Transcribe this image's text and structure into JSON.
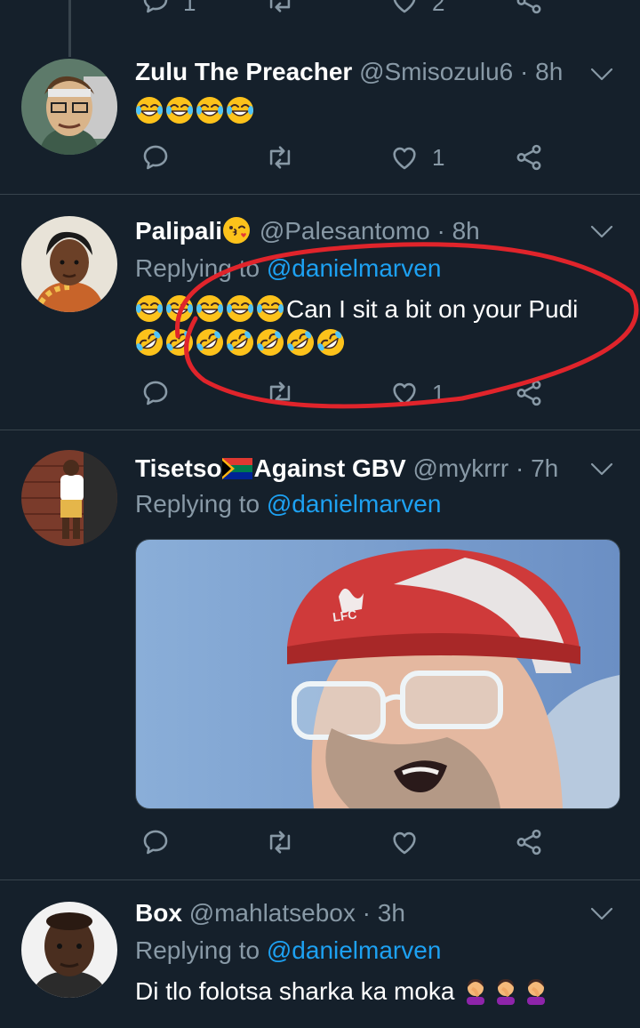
{
  "top_partial": {
    "reply_count": "1",
    "like_count": "2"
  },
  "tweets": [
    {
      "name": "Zulu The Preacher",
      "handle": "@Smisozulu6",
      "time": "8h",
      "text": "",
      "text_emojis": [
        "joy",
        "joy",
        "joy",
        "joy"
      ],
      "reply_count": "",
      "retweet_count": "",
      "like_count": "1"
    },
    {
      "name": "Palipali",
      "name_emoji": "kissing-heart",
      "handle": "@Palesantomo",
      "time": "8h",
      "replying_prefix": "Replying to",
      "replying_to": "@danielmarven",
      "text_line1": "Can I sit a bit on your Pudi",
      "text_line1_emojis": [
        "joy",
        "joy",
        "joy",
        "joy",
        "joy"
      ],
      "text_line2_emojis": [
        "rofl",
        "rofl",
        "rofl",
        "rofl",
        "rofl",
        "rofl",
        "rofl"
      ],
      "like_count": "1"
    },
    {
      "name": "Tisetso",
      "name_flag": "south-africa-flag",
      "name_suffix": "Against GBV",
      "handle": "@mykrrr",
      "time": "7h",
      "replying_prefix": "Replying to",
      "replying_to": "@danielmarven",
      "media": "photo-man-in-red-lfc-cap",
      "media_cap_text": "LFC"
    },
    {
      "name": "Box",
      "handle": "@mahlatsebox",
      "time": "3h",
      "replying_prefix": "Replying to",
      "replying_to": "@danielmarven",
      "text": "Di tlo folotsa sharka ka moka",
      "text_emojis": [
        "facepalm",
        "facepalm",
        "facepalm"
      ]
    }
  ],
  "colors": {
    "background": "#15202b",
    "divider": "#38444d",
    "secondary_text": "#8899a6",
    "link": "#1da1f2",
    "annotation_circle": "#e0242b"
  },
  "icons": [
    "reply-icon",
    "retweet-icon",
    "like-icon",
    "share-icon",
    "chevron-down-icon"
  ]
}
